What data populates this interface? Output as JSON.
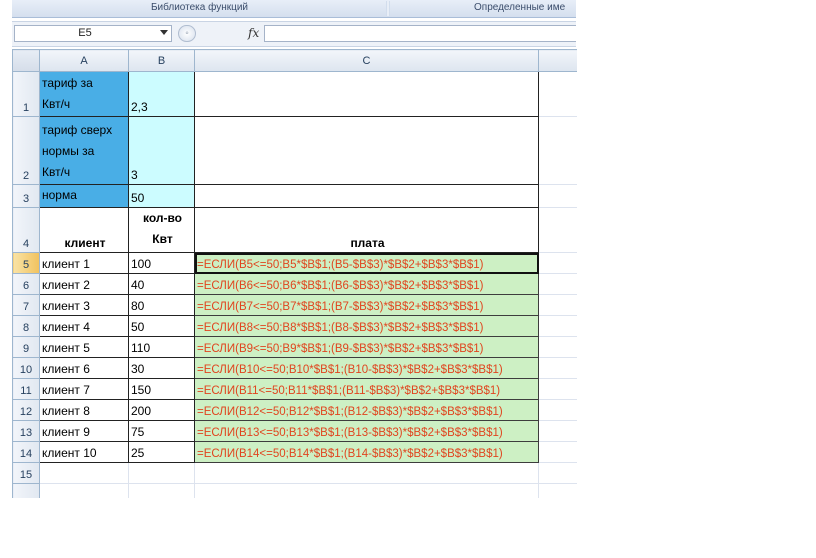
{
  "ribbon": {
    "group_function_library": "Библиотека функций",
    "group_defined_names": "Определенные име"
  },
  "formula_bar": {
    "name_box": "E5",
    "fx": "fx",
    "formula": ""
  },
  "columns": [
    "A",
    "B",
    "C"
  ],
  "rows": [
    {
      "num": "1",
      "a": "тариф за\nКвт/ч",
      "b": "2,3",
      "c": ""
    },
    {
      "num": "2",
      "a": "тариф сверх\nнормы за\nКвт/ч",
      "b": "3",
      "c": ""
    },
    {
      "num": "3",
      "a": "норма",
      "b": "50",
      "c": ""
    },
    {
      "num": "4",
      "a": "клиент",
      "b": "кол-во\nКвт",
      "c": "плата"
    },
    {
      "num": "5",
      "a": "клиент 1",
      "b": "100",
      "c": "=ЕСЛИ(B5<=50;B5*$B$1;(B5-$B$3)*$B$2+$B$3*$B$1)"
    },
    {
      "num": "6",
      "a": "клиент 2",
      "b": "40",
      "c": "=ЕСЛИ(B6<=50;B6*$B$1;(B6-$B$3)*$B$2+$B$3*$B$1)"
    },
    {
      "num": "7",
      "a": "клиент 3",
      "b": "80",
      "c": "=ЕСЛИ(B7<=50;B7*$B$1;(B7-$B$3)*$B$2+$B$3*$B$1)"
    },
    {
      "num": "8",
      "a": "клиент 4",
      "b": "50",
      "c": "=ЕСЛИ(B8<=50;B8*$B$1;(B8-$B$3)*$B$2+$B$3*$B$1)"
    },
    {
      "num": "9",
      "a": "клиент 5",
      "b": "110",
      "c": "=ЕСЛИ(B9<=50;B9*$B$1;(B9-$B$3)*$B$2+$B$3*$B$1)"
    },
    {
      "num": "10",
      "a": "клиент 6",
      "b": "30",
      "c": "=ЕСЛИ(B10<=50;B10*$B$1;(B10-$B$3)*$B$2+$B$3*$B$1)"
    },
    {
      "num": "11",
      "a": "клиент 7",
      "b": "150",
      "c": "=ЕСЛИ(B11<=50;B11*$B$1;(B11-$B$3)*$B$2+$B$3*$B$1)"
    },
    {
      "num": "12",
      "a": "клиент 8",
      "b": "200",
      "c": "=ЕСЛИ(B12<=50;B12*$B$1;(B12-$B$3)*$B$2+$B$3*$B$1)"
    },
    {
      "num": "13",
      "a": "клиент 9",
      "b": "75",
      "c": "=ЕСЛИ(B13<=50;B13*$B$1;(B13-$B$3)*$B$2+$B$3*$B$1)"
    },
    {
      "num": "14",
      "a": "клиент 10",
      "b": "25",
      "c": "=ЕСЛИ(B14<=50;B14*$B$1;(B14-$B$3)*$B$2+$B$3*$B$1)"
    },
    {
      "num": "15",
      "a": "",
      "b": "",
      "c": ""
    }
  ],
  "colors": {
    "header_blue": "#49aee6",
    "value_cyan": "#ccfcff",
    "formula_green": "#cdf0c4",
    "formula_text": "#e0451f"
  }
}
